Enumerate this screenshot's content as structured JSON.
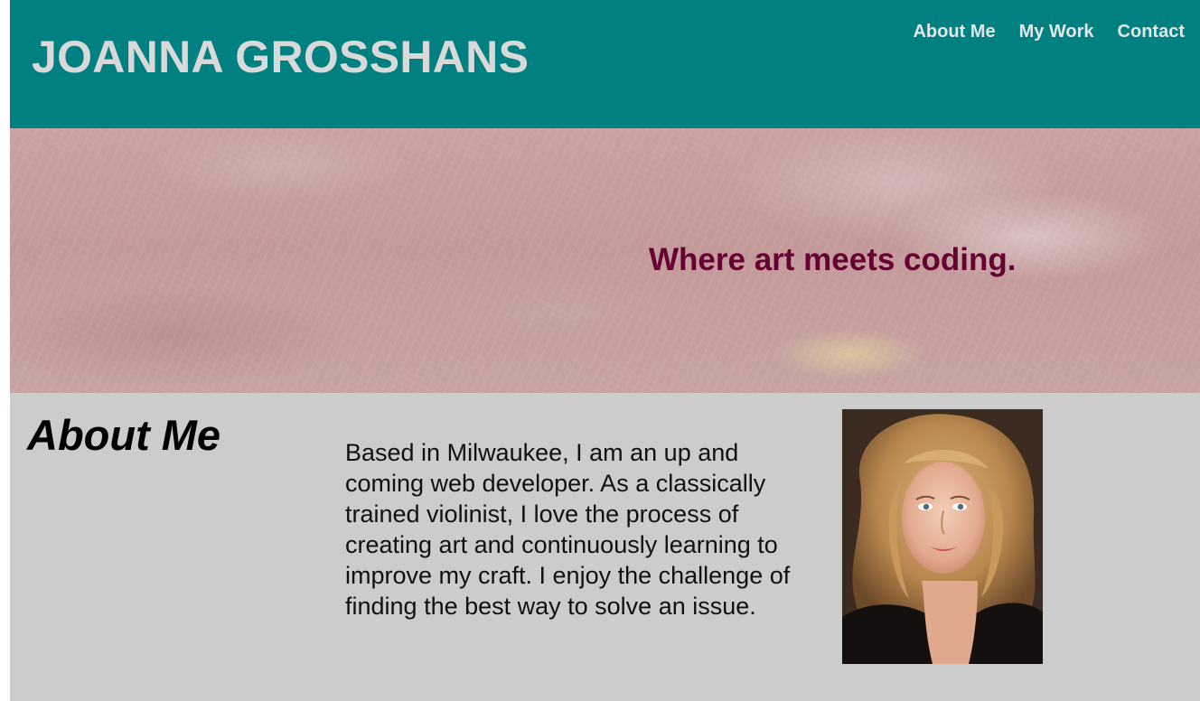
{
  "header": {
    "site_title": "JOANNA GROSSHANS",
    "nav": [
      {
        "label": "About Me"
      },
      {
        "label": "My Work"
      },
      {
        "label": "Contact"
      }
    ]
  },
  "hero": {
    "tagline": "Where art meets coding."
  },
  "about": {
    "heading": "About Me",
    "body": "Based in Milwaukee, I am an up and coming web developer. As a classically trained violinist, I love the process of creating art and continuously learning to improve my craft. I enjoy the challenge of finding the best way to solve an issue."
  },
  "colors": {
    "header_bg": "#008080",
    "header_text": "#d9d9d9",
    "tagline": "#660033",
    "page_bg": "#cccccc"
  }
}
